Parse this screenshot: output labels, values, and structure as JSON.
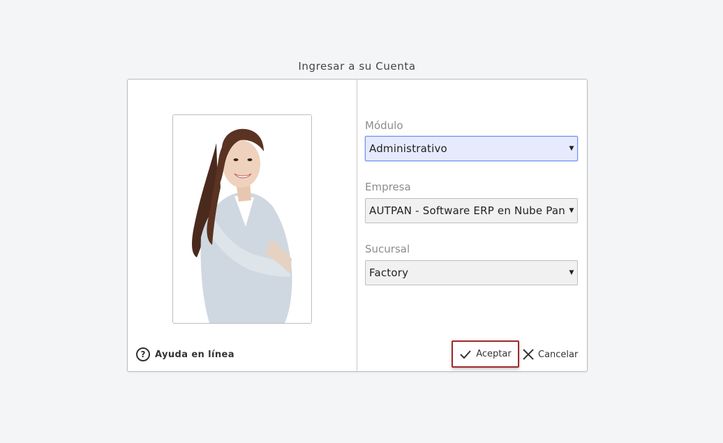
{
  "page": {
    "title": "Ingresar a su Cuenta"
  },
  "help": {
    "icon": "help-circle-icon",
    "label": "Ayuda en línea"
  },
  "form": {
    "modulo": {
      "label": "Módulo",
      "value": "Administrativo"
    },
    "empresa": {
      "label": "Empresa",
      "value": "AUTPAN - Software ERP en Nube Pana"
    },
    "sucursal": {
      "label": "Sucursal",
      "value": "Factory"
    }
  },
  "buttons": {
    "accept": {
      "label": "Aceptar",
      "icon": "check-icon"
    },
    "cancel": {
      "label": "Cancelar",
      "icon": "close-icon"
    }
  },
  "colors": {
    "active_select_bg": "#e6eafd",
    "active_select_border": "#6f8ff0",
    "accept_highlight_border": "#a2272d"
  }
}
